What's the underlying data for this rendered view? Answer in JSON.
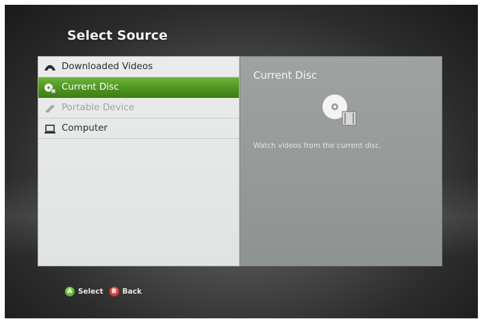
{
  "header": {
    "title": "Select Source"
  },
  "sources": [
    {
      "label": "Downloaded Videos",
      "icon": "download-icon",
      "state": "normal"
    },
    {
      "label": "Current Disc",
      "icon": "disc-icon",
      "state": "selected"
    },
    {
      "label": "Portable Device",
      "icon": "portable-device-icon",
      "state": "disabled"
    },
    {
      "label": "Computer",
      "icon": "computer-icon",
      "state": "normal"
    }
  ],
  "detail": {
    "title": "Current Disc",
    "icon": "disc-video-icon",
    "description": "Watch videos from the current disc."
  },
  "hints": [
    {
      "glyph": "A",
      "label": "Select",
      "color": "#4fa81f"
    },
    {
      "glyph": "B",
      "label": "Back",
      "color": "#d42a2a"
    }
  ],
  "colors": {
    "selection": "#4f9420",
    "list_background": "#e5e8e6",
    "detail_background": "#969b9a"
  }
}
